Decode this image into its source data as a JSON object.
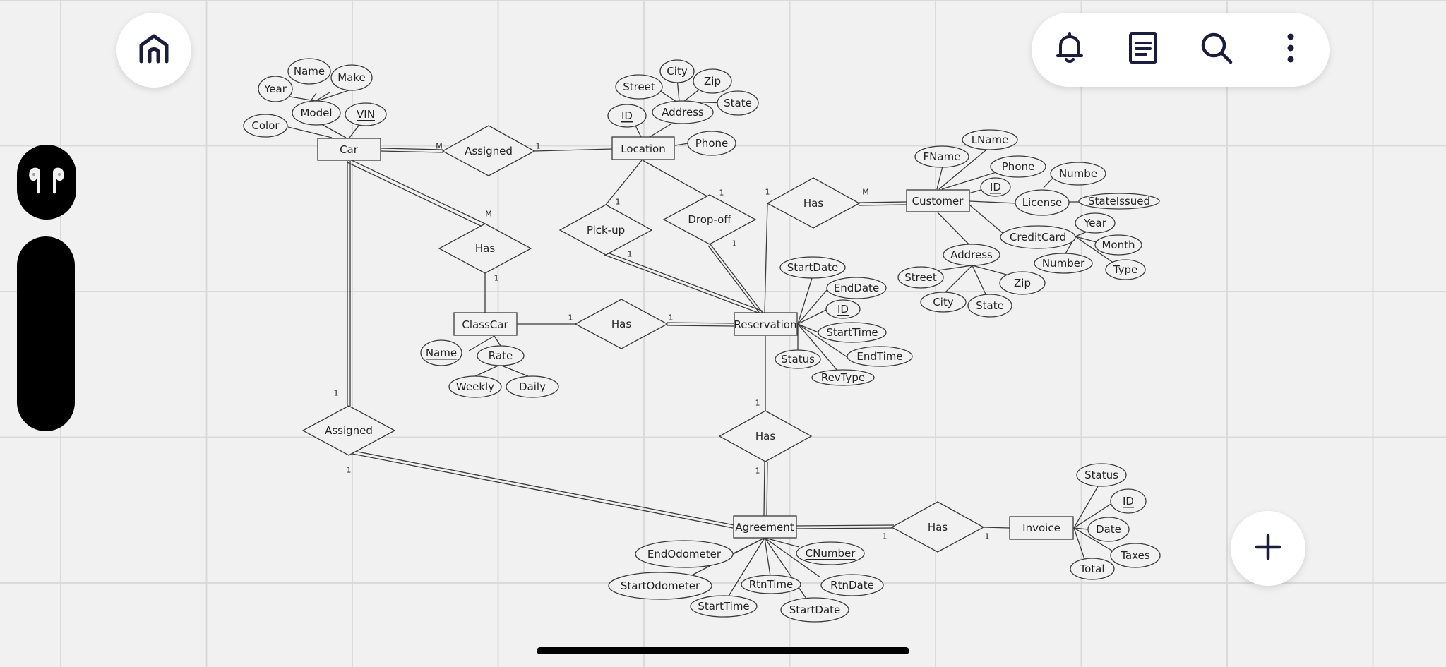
{
  "icons": {
    "home": "home-icon",
    "bell": "bell-icon",
    "notes": "document-icon",
    "search": "search-icon",
    "more": "more-vertical-icon",
    "add": "plus-icon",
    "airpods": "airpods-icon"
  },
  "colors": {
    "accent": "#1c1c3c",
    "canvas": "#f1f1f1",
    "grid": "#dadada",
    "line": "#3a3a3a"
  },
  "diagram": {
    "entities": {
      "car": "Car",
      "location": "Location",
      "customer": "Customer",
      "classcar": "ClassCar",
      "reservation": "Reservation",
      "agreement": "Agreement",
      "invoice": "Invoice"
    },
    "relationships": {
      "assigned_top": "Assigned",
      "has_car_class": "Has",
      "pickup": "Pick-up",
      "dropoff": "Drop-off",
      "has_customer": "Has",
      "has_class_res": "Has",
      "has_res_agr": "Has",
      "assigned_bottom": "Assigned",
      "has_agr_inv": "Has"
    },
    "attributes": {
      "car_year": "Year",
      "car_name": "Name",
      "car_make": "Make",
      "car_model": "Model",
      "car_vin": "VIN",
      "car_color": "Color",
      "loc_city": "City",
      "loc_zip": "Zip",
      "loc_street": "Street",
      "loc_state": "State",
      "loc_address": "Address",
      "loc_id": "ID",
      "loc_phone": "Phone",
      "cus_lname": "LName",
      "cus_fname": "FName",
      "cus_phone": "Phone",
      "cus_numbe": "Numbe",
      "cus_id": "ID",
      "cus_license": "License",
      "cus_stateissued": "StateIssued",
      "cus_year": "Year",
      "cus_creditcard": "CreditCard",
      "cus_month": "Month",
      "cus_number": "Number",
      "cus_type": "Type",
      "cus_address": "Address",
      "cus_street": "Street",
      "cus_zip": "Zip",
      "cus_city": "City",
      "cus_state": "State",
      "res_startdate": "StartDate",
      "res_enddate": "EndDate",
      "res_id": "ID",
      "res_starttime": "StartTime",
      "res_status": "Status",
      "res_endtime": "EndTime",
      "res_revtype": "RevType",
      "cls_name": "Name",
      "cls_rate": "Rate",
      "cls_weekly": "Weekly",
      "cls_daily": "Daily",
      "inv_status": "Status",
      "inv_id": "ID",
      "inv_date": "Date",
      "inv_taxes": "Taxes",
      "inv_total": "Total",
      "agr_endodometer": "EndOdometer",
      "agr_cnumber": "CNumber",
      "agr_startodometer": "StartOdometer",
      "agr_rtntime": "RtnTime",
      "agr_rtndate": "RtnDate",
      "agr_starttime": "StartTime",
      "agr_startdate": "StartDate"
    },
    "cardinalities": {
      "m": "M",
      "one": "1"
    }
  }
}
